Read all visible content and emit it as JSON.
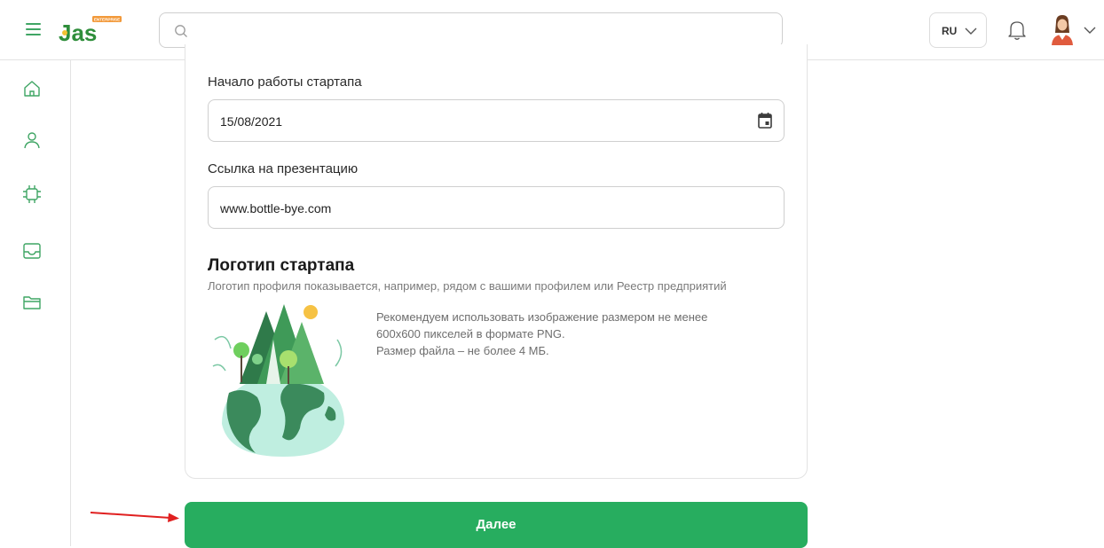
{
  "header": {
    "logo_text": "Jas",
    "logo_badge": "ENTERPRISE",
    "search_placeholder": "",
    "search_value": "",
    "language": "RU"
  },
  "sidebar": {
    "items": [
      {
        "icon": "home-icon"
      },
      {
        "icon": "user-icon"
      },
      {
        "icon": "chip-icon"
      },
      {
        "icon": "inbox-icon"
      },
      {
        "icon": "folder-icon"
      }
    ]
  },
  "form": {
    "start_label": "Начало работы стартапа",
    "start_value": "15/08/2021",
    "presentation_label": "Ссылка на презентацию",
    "presentation_value": "www.bottle-bye.com"
  },
  "logo_section": {
    "title": "Логотип стартапа",
    "description": "Логотип профиля показывается, например, рядом с вашими профилем или Реестр предприятий",
    "rec_line1": "Рекомендуем использовать изображение размером не менее",
    "rec_line2": "600x600 пикселей в формате PNG.",
    "rec_line3": "Размер файла – не более 4 МБ."
  },
  "actions": {
    "next_label": "Далее"
  },
  "colors": {
    "accent": "#27ad5f",
    "icon_green": "#3fa564",
    "annotation_arrow": "#e02020"
  }
}
